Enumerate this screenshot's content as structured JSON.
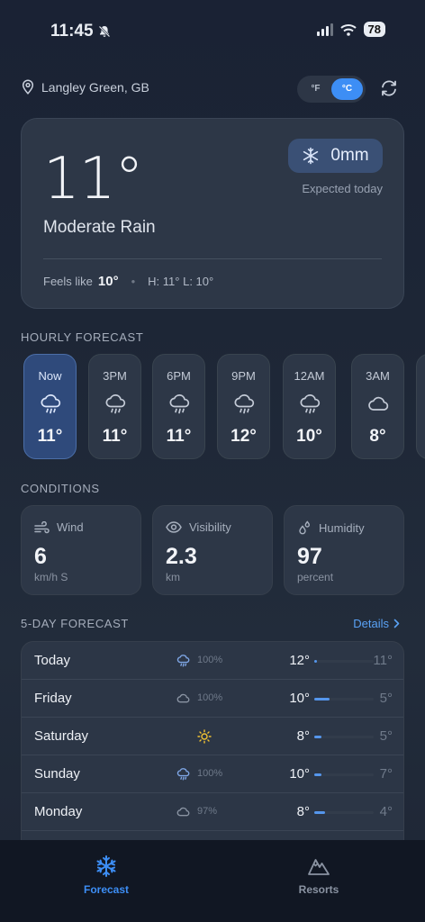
{
  "status_bar": {
    "time": "11:45",
    "battery": "78"
  },
  "header": {
    "location": "Langley Green, GB",
    "unit_f": "°F",
    "unit_c": "°C",
    "active_unit": "C"
  },
  "current": {
    "temp": "11°",
    "condition": "Moderate Rain",
    "snow": "0mm",
    "snow_caption": "Expected today",
    "feels_like_label": "Feels like",
    "feels_like": "10°",
    "high_low": "H: 11° L: 10°"
  },
  "hourly": {
    "title": "HOURLY FORECAST",
    "items": [
      {
        "label": "Now",
        "icon": "rain-cloud-icon",
        "temp": "11°"
      },
      {
        "label": "3PM",
        "icon": "rain-cloud-icon",
        "temp": "11°"
      },
      {
        "label": "6PM",
        "icon": "rain-cloud-icon",
        "temp": "11°"
      },
      {
        "label": "9PM",
        "icon": "rain-cloud-icon",
        "temp": "12°"
      },
      {
        "label": "12AM",
        "icon": "rain-cloud-icon",
        "temp": "10°"
      },
      {
        "label": "3AM",
        "icon": "cloud-icon",
        "temp": "8°"
      }
    ]
  },
  "conditions": {
    "title": "CONDITIONS",
    "wind": {
      "label": "Wind",
      "value": "6",
      "unit": "km/h S"
    },
    "visibility": {
      "label": "Visibility",
      "value": "2.3",
      "unit": "km"
    },
    "humidity": {
      "label": "Humidity",
      "value": "97",
      "unit": "percent"
    }
  },
  "five_day": {
    "title": "5-DAY FORECAST",
    "details_label": "Details",
    "rows": [
      {
        "day": "Today",
        "icon": "rain-cloud-icon",
        "precip": "100%",
        "high": "12°",
        "low": "11°",
        "range_start": 0.0,
        "range_end": 0.05
      },
      {
        "day": "Friday",
        "icon": "cloud-icon",
        "precip": "100%",
        "high": "10°",
        "low": "5°",
        "range_start": 0.0,
        "range_end": 0.25
      },
      {
        "day": "Saturday",
        "icon": "sun-icon",
        "precip": "",
        "high": "8°",
        "low": "5°",
        "range_start": 0.0,
        "range_end": 0.12
      },
      {
        "day": "Sunday",
        "icon": "rain-cloud-icon",
        "precip": "100%",
        "high": "10°",
        "low": "7°",
        "range_start": 0.0,
        "range_end": 0.12
      },
      {
        "day": "Monday",
        "icon": "cloud-icon",
        "precip": "97%",
        "high": "8°",
        "low": "4°",
        "range_start": 0.0,
        "range_end": 0.18
      }
    ]
  },
  "tabs": {
    "forecast": "Forecast",
    "resorts": "Resorts",
    "active": "forecast"
  },
  "colors": {
    "accent": "#3d8ef5",
    "link": "#5aa2f5",
    "sun": "#f1c232"
  }
}
